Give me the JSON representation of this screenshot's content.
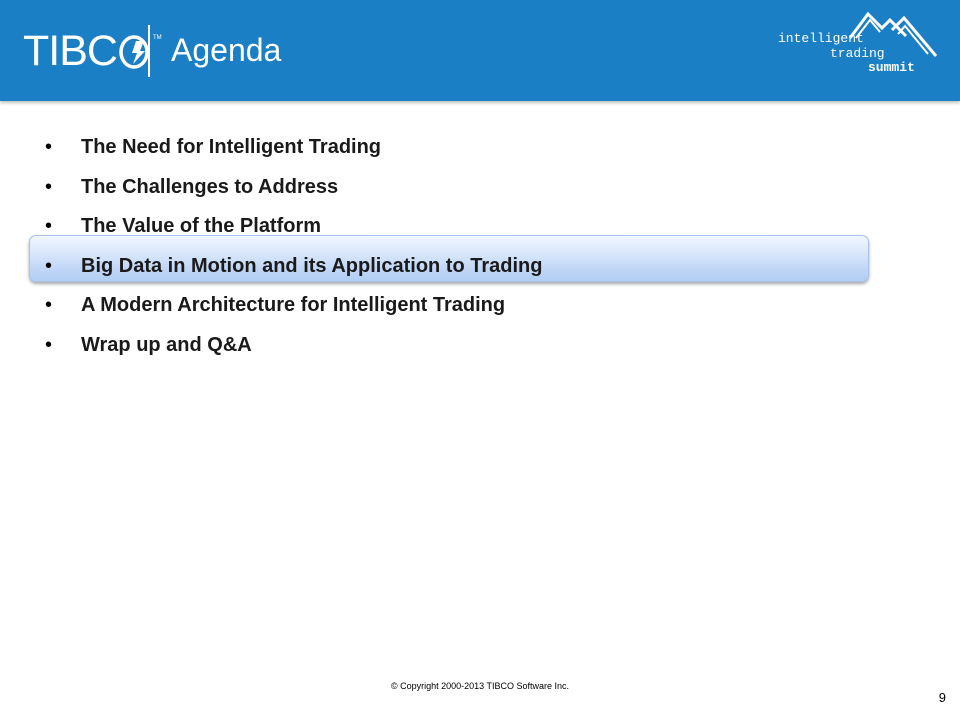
{
  "header": {
    "logo_text": "TIBC",
    "logo_tm": "TM",
    "title": "Agenda",
    "brand_color": "#1b7fc6",
    "summit_logo": {
      "line1": "intelligent",
      "line2": "trading",
      "line3": "summit",
      "icon": "mountains-icon"
    }
  },
  "agenda": {
    "bullet": "•",
    "highlight_color": "#c2d7f7",
    "items": [
      {
        "label": "The Need for Intelligent Trading"
      },
      {
        "label": "The Challenges to Address"
      },
      {
        "label": "The Value of the Platform"
      },
      {
        "label": "Big Data in Motion and its Application to Trading",
        "highlighted": true
      },
      {
        "label": "A Modern Architecture for Intelligent Trading"
      },
      {
        "label": "Wrap up and Q&A"
      }
    ]
  },
  "footer": {
    "copyright": "© Copyright 2000-2013 TIBCO Software Inc.",
    "page_number": "9"
  }
}
